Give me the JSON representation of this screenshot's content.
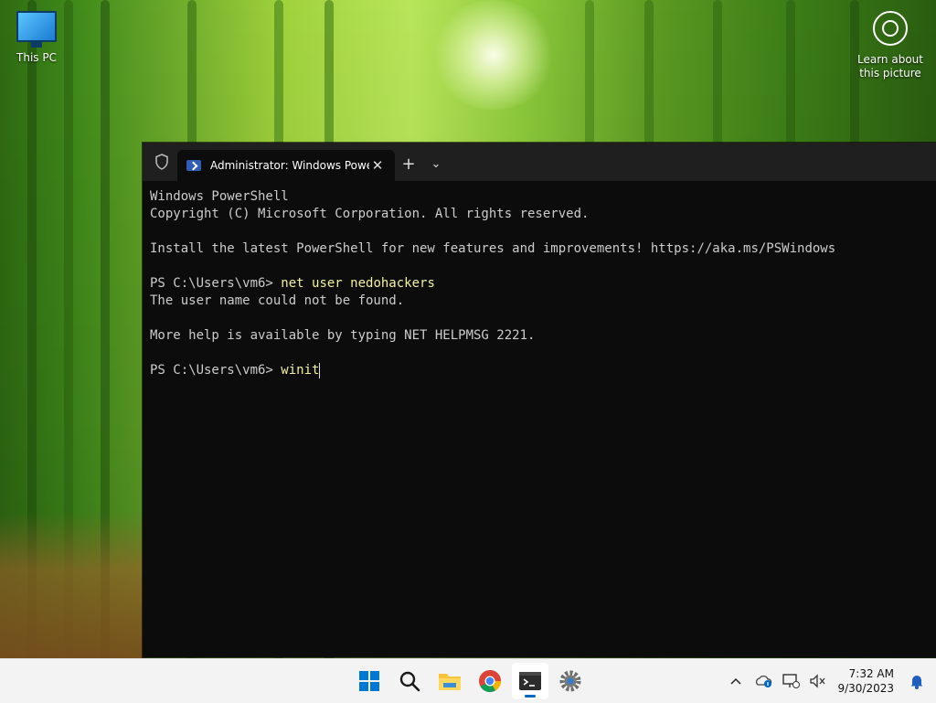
{
  "desktop": {
    "this_pc_label": "This PC",
    "learn_label": "Learn about this picture"
  },
  "window": {
    "tab_title": "Administrator: Windows PowerShell",
    "console": {
      "line1": "Windows PowerShell",
      "line2": "Copyright (C) Microsoft Corporation. All rights reserved.",
      "line3": "",
      "line4": "Install the latest PowerShell for new features and improvements! https://aka.ms/PSWindows",
      "line5": "",
      "prompt": "PS C:\\Users\\vm6> ",
      "cmd1": "net user nedohackers",
      "out1": "The user name could not be found.",
      "out2": "",
      "out3": "More help is available by typing NET HELPMSG 2221.",
      "out4": "",
      "cmd2": "winit"
    }
  },
  "taskbar": {
    "time": "7:32 AM",
    "date": "9/30/2023"
  },
  "colors": {
    "accent": "#0078d4",
    "console_bg": "#0c0c0c",
    "console_text": "#cccccc",
    "command_text": "#f2f2a0"
  }
}
